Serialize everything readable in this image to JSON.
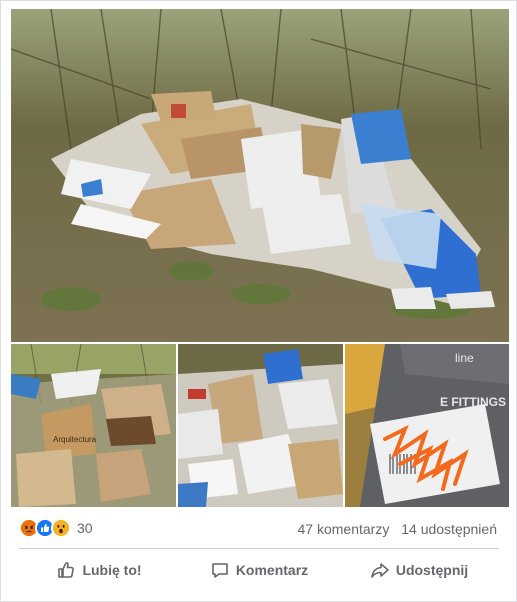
{
  "photos": [
    {
      "name": "main",
      "alt": ""
    },
    {
      "name": "s1",
      "alt": ""
    },
    {
      "name": "s2",
      "alt": ""
    },
    {
      "name": "s3",
      "alt": ""
    }
  ],
  "photo_labels": {
    "box_brand": "Arquitectura",
    "label_text": "E FITTINGS",
    "label_logo": "line"
  },
  "reactions": {
    "icons": [
      "angry-icon",
      "like-icon",
      "wow-icon"
    ],
    "count": "30"
  },
  "stats": {
    "comments": "47 komentarzy",
    "shares": "14 udostępnień"
  },
  "actions": {
    "like": "Lubię to!",
    "comment": "Komentarz",
    "share": "Udostępnij"
  },
  "colors": {
    "like_blue": "#1877f2",
    "angry": "#e9710f",
    "wow": "#f7b125",
    "muted_text": "#65676b"
  }
}
